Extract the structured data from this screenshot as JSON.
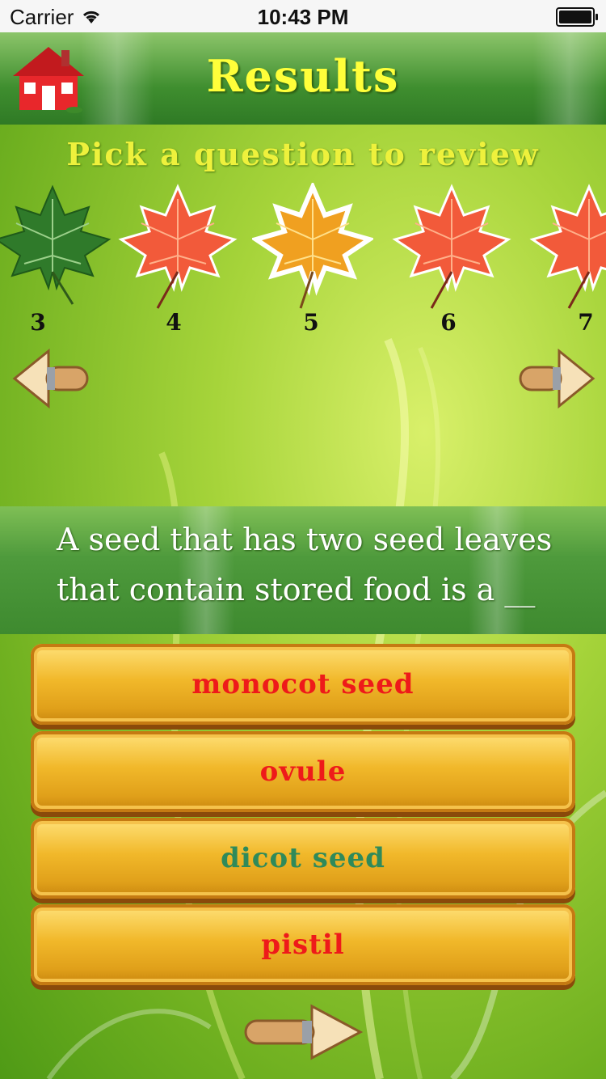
{
  "status": {
    "carrier": "Carrier",
    "time": "10:43 PM"
  },
  "header": {
    "title": "Results",
    "home_icon": "home-icon"
  },
  "review": {
    "prompt": "Pick a question to review",
    "leaves": [
      {
        "number": "3",
        "color": "green"
      },
      {
        "number": "4",
        "color": "red"
      },
      {
        "number": "5",
        "color": "orange",
        "selected": true
      },
      {
        "number": "6",
        "color": "red"
      },
      {
        "number": "7",
        "color": "red"
      }
    ]
  },
  "question": {
    "text": "A seed that has two seed leaves that contain stored food is a __"
  },
  "answers": [
    {
      "label": "monocot seed",
      "color": "#ee1a1a"
    },
    {
      "label": "ovule",
      "color": "#ee1a1a"
    },
    {
      "label": "dicot seed",
      "color": "#2f8a5a",
      "correct": true
    },
    {
      "label": "pistil",
      "color": "#ee1a1a"
    }
  ],
  "colors": {
    "green_leaf": "#2f7a2a",
    "red_leaf": "#f25a3a",
    "orange_leaf": "#f0a020",
    "title": "#ffff3a"
  }
}
